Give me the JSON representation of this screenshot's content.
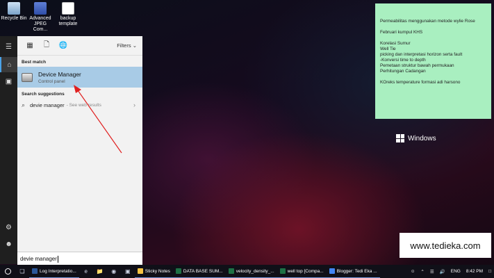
{
  "desktop_icons": [
    {
      "label": "Recycle Bin",
      "icon": "recycle-bin-icon"
    },
    {
      "label": "Advanced JPEG Com...",
      "icon": "jpeg-app-icon"
    },
    {
      "label": "backup template",
      "icon": "document-icon"
    }
  ],
  "start_menu": {
    "filters_label": "Filters",
    "best_match_header": "Best match",
    "best_match": {
      "title": "Device Manager",
      "subtitle": "Control panel"
    },
    "suggestions_header": "Search suggestions",
    "suggestion": {
      "query": "devie manager",
      "hint": "- See web results"
    },
    "search_value": "devie manager"
  },
  "sticky_note": {
    "lines": [
      "Permeabilitas menggunakan metode wylie Rose",
      "",
      "Februari kumpul KHS",
      "",
      "Korelasi Sumur",
      "Well Tie",
      "picking dan interpretasi horizon serta fault",
      "-Konversi time to depth",
      "Pemetaan struktur bawah permukaan",
      "Perhitungan Cadangan",
      "",
      "KOreks temperature formasi adi harsono"
    ]
  },
  "windows_label": "Windows",
  "watermark": "www.tedieka.com",
  "taskbar": {
    "items": [
      {
        "label": "Log Interpretatio...",
        "color": "#2b579a"
      },
      {
        "label": "Sticky Notes",
        "color": "#f6c343"
      },
      {
        "label": "DATA BASE SUM...",
        "color": "#1e7145"
      },
      {
        "label": "velocity_density_...",
        "color": "#1e7145"
      },
      {
        "label": "well top  [Compa...",
        "color": "#1e7145"
      },
      {
        "label": "Blogger: Tedi Eka ...",
        "color": "#4285f4"
      }
    ],
    "language": "ENG",
    "time": "8:42 PM"
  },
  "colors": {
    "accent": "#4aa3e8",
    "selection": "#a8cbe6",
    "sticky": "#a9efc0",
    "arrow": "#e02020"
  }
}
